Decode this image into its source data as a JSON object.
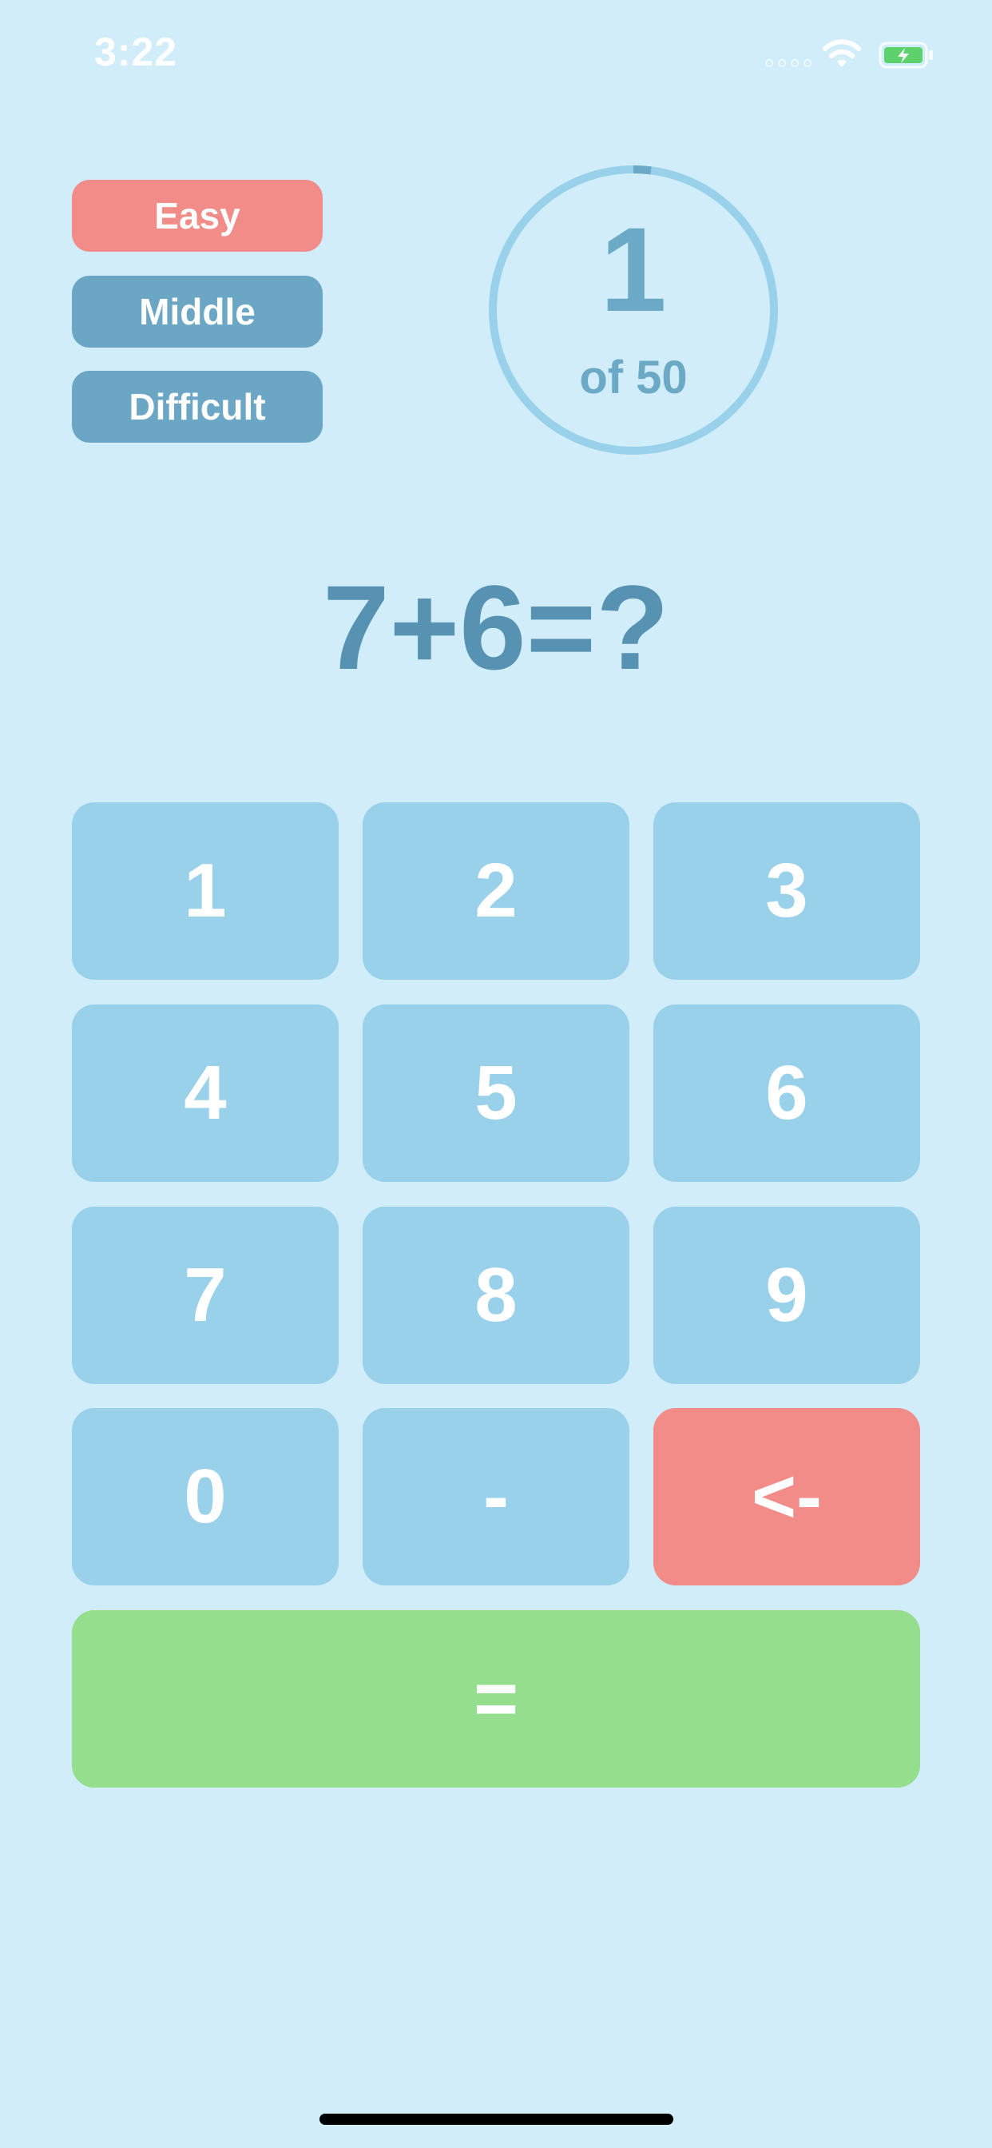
{
  "status_bar": {
    "time": "3:22"
  },
  "difficulty": {
    "easy": "Easy",
    "middle": "Middle",
    "difficult": "Difficult",
    "selected_color": "#F28C88",
    "unselected_color": "#6BA7C4"
  },
  "progress": {
    "current": "1",
    "total_label": "of 50",
    "fraction": 0.02
  },
  "question": "7+6=?",
  "keypad": {
    "keys": [
      "1",
      "2",
      "3",
      "4",
      "5",
      "6",
      "7",
      "8",
      "9",
      "0",
      "-",
      "<-"
    ],
    "equals": "="
  },
  "colors": {
    "background": "#D0EDF9",
    "key": "#99D1EB",
    "backspace": "#F28C88",
    "equals": "#94DE8E",
    "text_accent": "#5792B3"
  }
}
